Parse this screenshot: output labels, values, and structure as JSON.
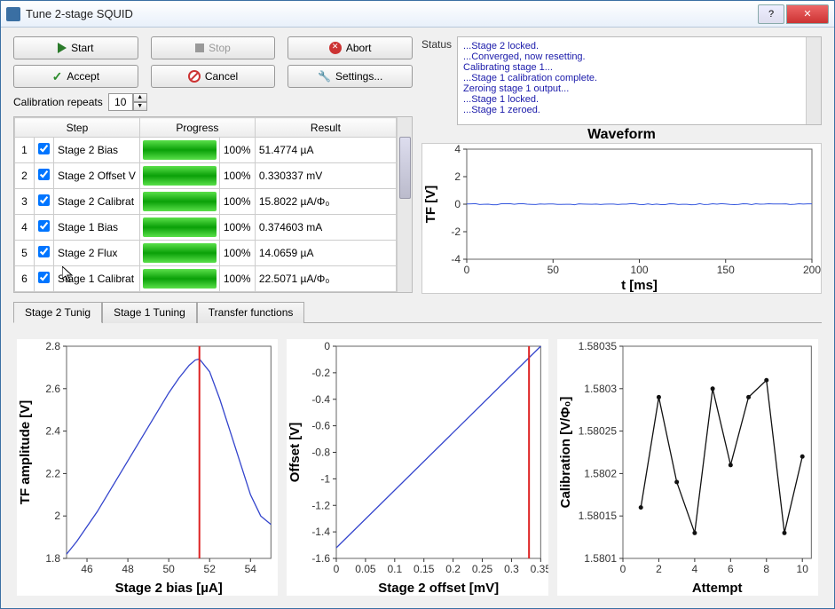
{
  "window": {
    "title": "Tune 2-stage SQUID"
  },
  "buttons": {
    "start": "Start",
    "stop": "Stop",
    "abort": "Abort",
    "accept": "Accept",
    "cancel": "Cancel",
    "settings": "Settings..."
  },
  "calibration": {
    "label": "Calibration repeats",
    "value": "10"
  },
  "status": {
    "label": "Status",
    "lines": [
      "...Stage 2 locked.",
      "...Converged, now resetting.",
      "Calibrating stage 1...",
      "...Stage 1 calibration complete.",
      "Zeroing stage 1 output...",
      "...Stage 1 locked.",
      "...Stage 1 zeroed."
    ]
  },
  "table": {
    "headers": {
      "step": "Step",
      "progress": "Progress",
      "result": "Result"
    },
    "rows": [
      {
        "n": "1",
        "name": "Stage 2 Bias",
        "pct": "100%",
        "result": "51.4774 µA"
      },
      {
        "n": "2",
        "name": "Stage 2 Offset V",
        "pct": "100%",
        "result": "0.330337 mV"
      },
      {
        "n": "3",
        "name": "Stage 2 Calibrat",
        "pct": "100%",
        "result": "15.8022 µA/Φ₀"
      },
      {
        "n": "4",
        "name": "Stage 1 Bias",
        "pct": "100%",
        "result": "0.374603 mA"
      },
      {
        "n": "5",
        "name": "Stage 2 Flux",
        "pct": "100%",
        "result": "14.0659 µA"
      },
      {
        "n": "6",
        "name": "Stage 1 Calibrat",
        "pct": "100%",
        "result": "22.5071 µA/Φ₀"
      }
    ]
  },
  "tabs": {
    "t1": "Stage 2 Tunig",
    "t2": "Stage 1 Tuning",
    "t3": "Transfer functions"
  },
  "chart_data": [
    {
      "type": "line",
      "id": "waveform",
      "title": "Waveform",
      "xlabel": "t [ms]",
      "ylabel": "TF [V]",
      "xlim": [
        0,
        200
      ],
      "ylim": [
        -4,
        4
      ],
      "xticks": [
        0,
        50,
        100,
        150,
        200
      ],
      "yticks": [
        -4,
        -2,
        0,
        2,
        4
      ],
      "series": [
        {
          "name": "TF",
          "y_const": 0,
          "color": "#3355dd"
        }
      ]
    },
    {
      "type": "line",
      "id": "bias",
      "title": "",
      "xlabel": "Stage 2 bias [µA]",
      "ylabel": "TF amplitude [V]",
      "xlim": [
        45,
        55
      ],
      "ylim": [
        1.8,
        2.8
      ],
      "xticks": [
        46,
        48,
        50,
        52,
        54
      ],
      "yticks": [
        1.8,
        2,
        2.2,
        2.4,
        2.6,
        2.8
      ],
      "series": [
        {
          "name": "amp",
          "color": "#3344cc",
          "x": [
            45,
            45.5,
            46,
            46.5,
            47,
            47.5,
            48,
            48.5,
            49,
            49.5,
            50,
            50.5,
            51,
            51.3,
            51.5,
            52,
            52.5,
            53,
            53.5,
            54,
            54.5,
            55
          ],
          "y": [
            1.82,
            1.88,
            1.95,
            2.02,
            2.1,
            2.18,
            2.26,
            2.34,
            2.42,
            2.5,
            2.58,
            2.65,
            2.71,
            2.735,
            2.74,
            2.68,
            2.55,
            2.4,
            2.25,
            2.1,
            2.0,
            1.96
          ]
        }
      ],
      "vline": 51.5
    },
    {
      "type": "line",
      "id": "offset",
      "title": "",
      "xlabel": "Stage 2 offset [mV]",
      "ylabel": "Offset [V]",
      "xlim": [
        0,
        0.35
      ],
      "ylim": [
        -1.6,
        0
      ],
      "xticks": [
        0,
        0.05,
        0.1,
        0.15,
        0.2,
        0.25,
        0.3,
        0.35
      ],
      "yticks": [
        -1.6,
        -1.4,
        -1.2,
        -1.0,
        -0.8,
        -0.6,
        -0.4,
        -0.2,
        0
      ],
      "series": [
        {
          "name": "off",
          "color": "#3344cc",
          "x": [
            0,
            0.35
          ],
          "y": [
            -1.52,
            0.0
          ]
        }
      ],
      "vline": 0.33
    },
    {
      "type": "line",
      "id": "calib",
      "title": "",
      "xlabel": "Attempt",
      "ylabel": "Calibration [V/Φ₀]",
      "xlim": [
        0,
        10.5
      ],
      "ylim": [
        1.5801,
        1.58035
      ],
      "xticks": [
        0,
        2,
        4,
        6,
        8,
        10
      ],
      "yticks": [
        1.5801,
        1.58015,
        1.5802,
        1.58025,
        1.5803,
        1.58035
      ],
      "series": [
        {
          "name": "cal",
          "color": "#111",
          "marker": true,
          "x": [
            1,
            2,
            3,
            4,
            5,
            6,
            7,
            8,
            9,
            10
          ],
          "y": [
            1.58016,
            1.58029,
            1.58019,
            1.58013,
            1.5803,
            1.58021,
            1.58029,
            1.58031,
            1.58013,
            1.58022
          ]
        }
      ]
    }
  ]
}
